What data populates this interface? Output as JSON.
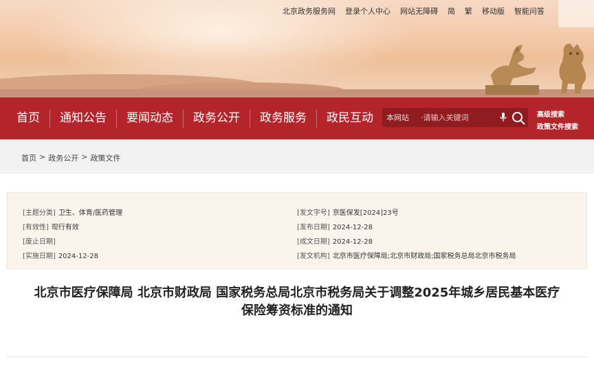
{
  "top_links": [
    "北京政务服务网",
    "登录个人中心",
    "网站无障碍",
    "简",
    "繁",
    "移动版",
    "智能问答"
  ],
  "nav": {
    "items": [
      "首页",
      "通知公告",
      "要闻动态",
      "政务公开",
      "政务服务",
      "政民互动"
    ]
  },
  "search": {
    "scope": "本网站",
    "placeholder": "·请输入关键词",
    "advanced": "高级搜索",
    "policy": "政策文件搜索"
  },
  "breadcrumb": [
    "首页",
    "政务公开",
    "政策文件"
  ],
  "breadcrumb_sep": ">",
  "meta": {
    "left": [
      {
        "k": "[主题分类]",
        "v": "卫生、体育/医药管理"
      },
      {
        "k": "[有效性]",
        "v": "现行有效"
      },
      {
        "k": "[废止日期]",
        "v": ""
      },
      {
        "k": "[实施日期]",
        "v": "2024-12-28"
      }
    ],
    "right": [
      {
        "k": "[发文字号]",
        "v": "京医保发[2024]23号"
      },
      {
        "k": "[发布日期]",
        "v": "2024-12-28"
      },
      {
        "k": "[成文日期]",
        "v": "2024-12-28"
      },
      {
        "k": "[发文机构]",
        "v": "北京市医疗保障局;北京市财政局;国家税务总局北京市税务局"
      }
    ]
  },
  "title_line1": "北京市医疗保障局 北京市财政局 国家税务总局北京市税务局关于调整2025年城乡居民基本医疗",
  "title_line2": "保险筹资标准的通知",
  "colors": {
    "nav_red": "#b3252a",
    "meta_bg": "#fbf4ec"
  }
}
